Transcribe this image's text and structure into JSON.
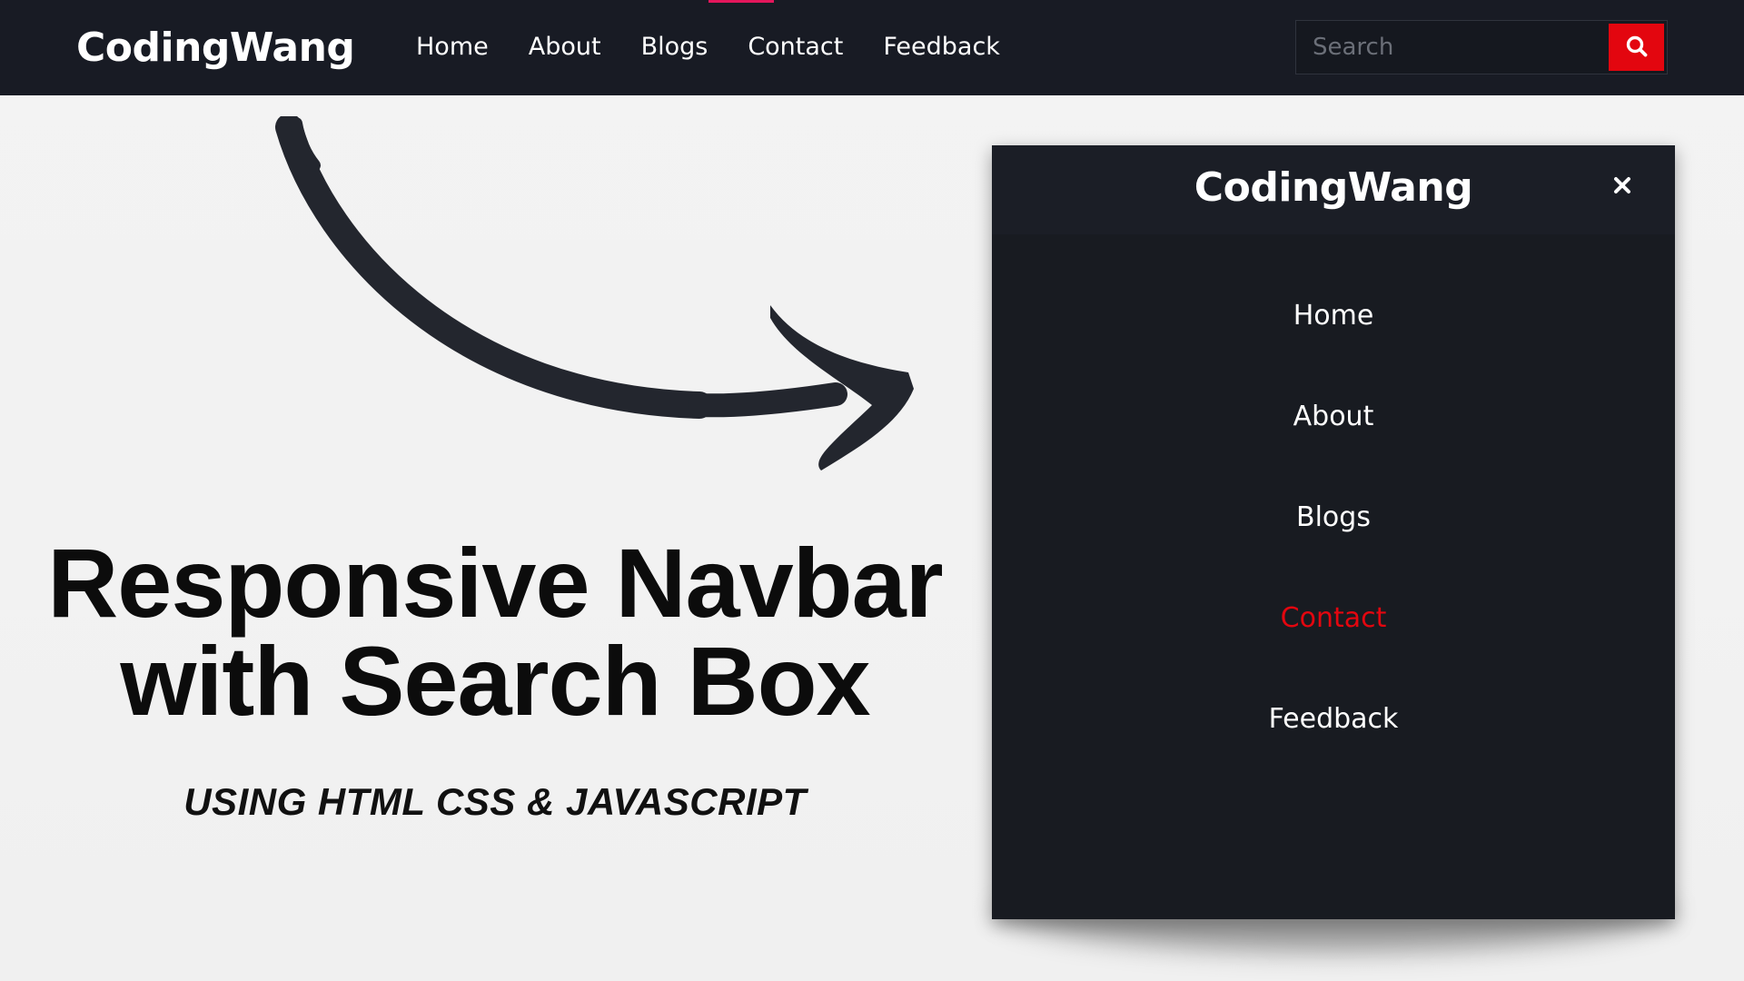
{
  "navbar": {
    "brand": "CodingWang",
    "links": [
      {
        "label": "Home"
      },
      {
        "label": "About"
      },
      {
        "label": "Blogs"
      },
      {
        "label": "Contact"
      },
      {
        "label": "Feedback"
      }
    ],
    "search": {
      "placeholder": "Search",
      "value": "",
      "button_icon": "search-icon"
    },
    "background_color": "#181b24",
    "accent_color": "#e3165b",
    "search_button_color": "#e3060f"
  },
  "headline": {
    "line1": "Responsive Navbar",
    "line2": "with Search Box",
    "subtitle": "USING HTML CSS & JAVASCRIPT"
  },
  "mobile_menu": {
    "brand": "CodingWang",
    "close_icon": "close-icon",
    "items": [
      {
        "label": "Home",
        "active": false
      },
      {
        "label": "About",
        "active": false
      },
      {
        "label": "Blogs",
        "active": false
      },
      {
        "label": "Contact",
        "active": true
      },
      {
        "label": "Feedback",
        "active": false
      }
    ],
    "active_color": "#e3060f"
  },
  "decor": {
    "arrow_icon": "curved-arrow-icon"
  }
}
